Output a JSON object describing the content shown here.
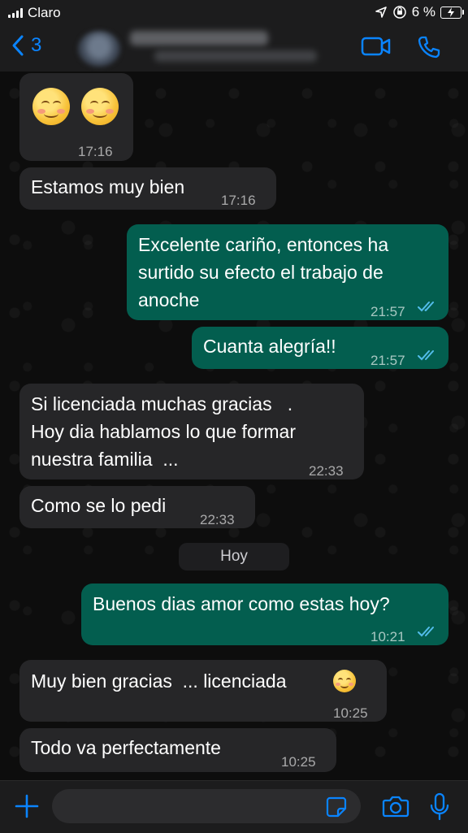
{
  "status_bar": {
    "carrier": "Claro",
    "battery_percent": "6 %"
  },
  "header": {
    "back_count": "3",
    "contact_name": "",
    "contact_subtitle": ""
  },
  "messages": [
    {
      "type": "in",
      "emoji": [
        "smiling-face-icon",
        "smiling-face-icon"
      ],
      "time": "17:16"
    },
    {
      "type": "in",
      "text": "Estamos muy bien",
      "time": "17:16"
    },
    {
      "type": "out",
      "text": "Excelente cariño, entonces ha\nsurtido su efecto el trabajo de\nanoche",
      "time": "21:57",
      "status": "read"
    },
    {
      "type": "out",
      "text": "Cuanta alegría!!",
      "time": "21:57",
      "status": "read"
    },
    {
      "type": "in",
      "text": "Si licenciada muchas gracias   .\nHoy dia hablamos lo que formar\nnuestra familia  ...",
      "time": "22:33"
    },
    {
      "type": "in",
      "text": "Como se lo pedi",
      "time": "22:33"
    },
    {
      "type": "out",
      "text": "Buenos dias amor como estas hoy?",
      "time": "10:21",
      "status": "read"
    },
    {
      "type": "in",
      "text": "Muy bien gracias  ... licenciada",
      "emoji_trailing": "smiling-face-icon",
      "time": "10:25"
    },
    {
      "type": "in",
      "text": "Todo va perfectamente",
      "time": "10:25"
    }
  ],
  "date_separator": "Hoy",
  "input": {
    "placeholder": ""
  },
  "colors": {
    "accent": "#0a84ff",
    "outgoing_bubble": "#035e4f",
    "incoming_bubble": "#262628",
    "read_ticks": "#53bdeb"
  }
}
